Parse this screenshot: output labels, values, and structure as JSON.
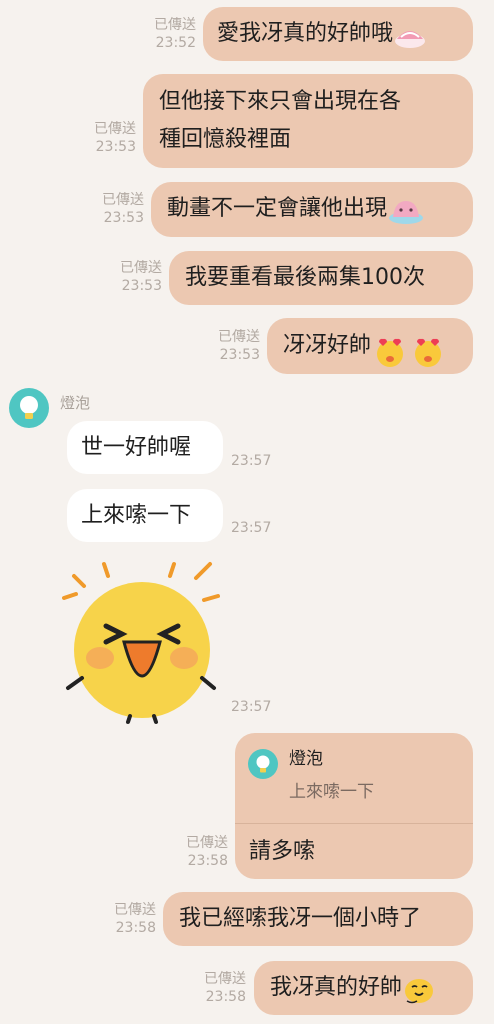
{
  "colors": {
    "background": "#f6f2ee",
    "outgoing_bubble": "#ecc8b1",
    "incoming_bubble": "#ffffff",
    "meta_text": "#b3aaa3",
    "avatar": "#4fc6c2"
  },
  "messages": [
    {
      "id": 1,
      "text": "愛我冴真的好帥哦",
      "emoji": "sushi-emoji",
      "status": "已傳送",
      "time": "23:52"
    },
    {
      "id": 2,
      "line1": "但他接下來只會出現在各",
      "line2": "種回憶殺裡面",
      "status": "已傳送",
      "time": "23:53"
    },
    {
      "id": 3,
      "text": "動畫不一定會讓他出現",
      "emoji": "pink-slime-emoji",
      "status": "已傳送",
      "time": "23:53"
    },
    {
      "id": 4,
      "text": "我要重看最後兩集100次",
      "status": "已傳送",
      "time": "23:53"
    },
    {
      "id": 5,
      "text": "冴冴好帥",
      "emoji": "heart-eyes-chick-emoji",
      "status": "已傳送",
      "time": "23:53"
    }
  ],
  "incoming": {
    "sender": "燈泡",
    "avatar_icon": "lightbulb-icon",
    "messages": [
      {
        "text": "世一好帥喔",
        "time": "23:57"
      },
      {
        "text": "上來嗦一下",
        "time": "23:57"
      },
      {
        "sticker": "excited-laughing-face-sticker",
        "time": "23:57"
      }
    ]
  },
  "reply": {
    "quoted_sender": "燈泡",
    "quoted_text": "上來嗦一下",
    "text": "請多嗦",
    "status": "已傳送",
    "time": "23:58"
  },
  "later": [
    {
      "text": "我已經嗦我冴一個小時了",
      "status": "已傳送",
      "time": "23:58"
    },
    {
      "text": "我冴真的好帥",
      "emoji": "smug-chick-emoji",
      "status": "已傳送",
      "time": "23:58"
    }
  ]
}
